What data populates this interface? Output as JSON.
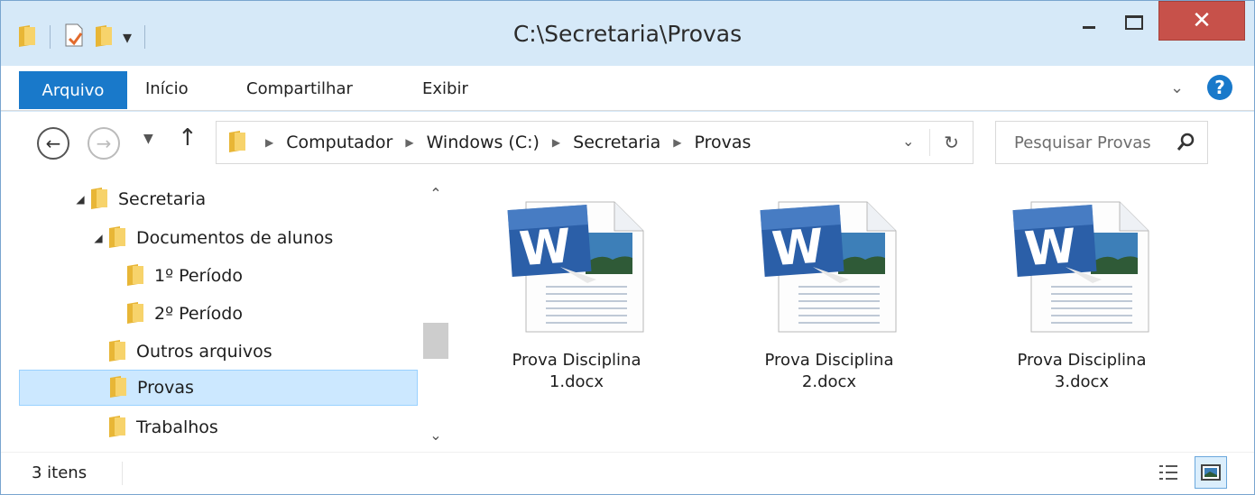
{
  "window": {
    "title": "C:\\Secretaria\\Provas",
    "close_glyph": "✕"
  },
  "ribbon": {
    "tabs": [
      "Arquivo",
      "Início",
      "Compartilhar",
      "Exibir"
    ]
  },
  "nav": {
    "breadcrumb": [
      "Computador",
      "Windows (C:)",
      "Secretaria",
      "Provas"
    ],
    "search_placeholder": "Pesquisar Provas"
  },
  "tree": {
    "items": [
      {
        "label": "Secretaria",
        "expanded": true
      },
      {
        "label": "Documentos de alunos",
        "expanded": true
      },
      {
        "label": "1º Período"
      },
      {
        "label": "2º Período"
      },
      {
        "label": "Outros arquivos"
      },
      {
        "label": "Provas",
        "selected": true
      },
      {
        "label": "Trabalhos"
      }
    ]
  },
  "files": [
    {
      "name": "Prova Disciplina 1.docx",
      "icon": "word-document-icon"
    },
    {
      "name": "Prova Disciplina 2.docx",
      "icon": "word-document-icon"
    },
    {
      "name": "Prova Disciplina 3.docx",
      "icon": "word-document-icon"
    }
  ],
  "status": {
    "item_count": "3 itens"
  },
  "colors": {
    "accent": "#1979ca",
    "close_button": "#c7514a",
    "selection": "#cce8ff",
    "window_frame": "#d6e9f8"
  }
}
